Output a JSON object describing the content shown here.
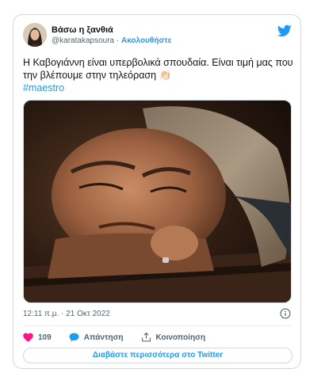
{
  "author": {
    "display_name": "Βάσω η ξανθιά",
    "handle": "@karatakapsoura",
    "separator": " · ",
    "follow_label": "Ακολουθήστε"
  },
  "tweet": {
    "text": "Η Καβογιάννη είναι υπερβολικά σπουδαία. Είναι τιμή μας που την βλέπουμε στην τηλεόραση 👏🏻",
    "hashtag": "#maestro",
    "timestamp": "12:11 π.μ. · 21 Οκτ 2022"
  },
  "actions": {
    "like_count": "109",
    "reply_label": "Απάντηση",
    "share_label": "Κοινοποίηση"
  },
  "footer": {
    "read_more_label": "Διαβάστε περισσότερα στο Twitter"
  },
  "colors": {
    "accent": "#1d9bf0",
    "like": "#f91880",
    "secondary_text": "#536471",
    "border": "#cfd9de"
  },
  "icons": [
    "twitter-bird-icon",
    "info-icon",
    "heart-icon",
    "reply-icon",
    "share-icon"
  ]
}
